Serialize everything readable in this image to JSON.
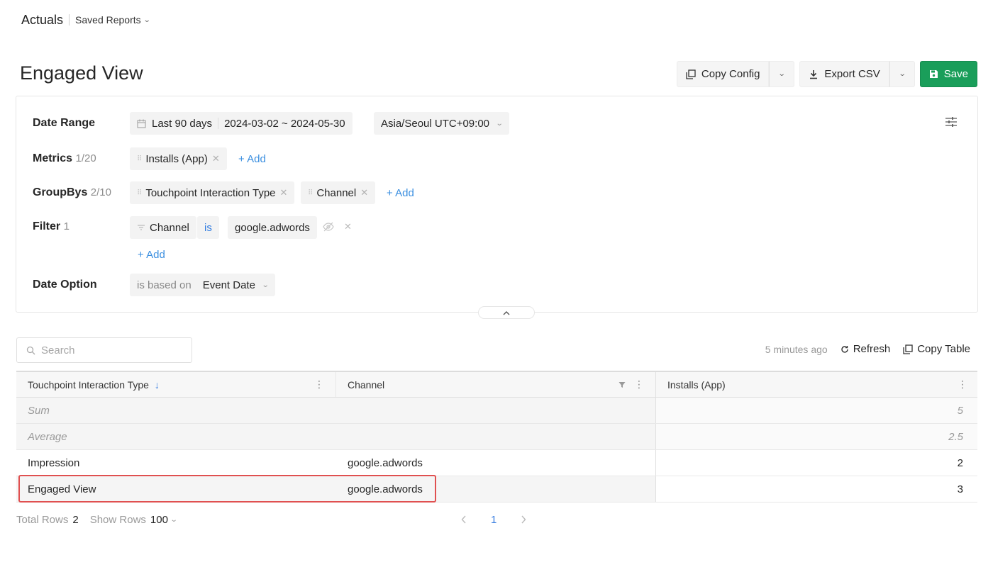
{
  "nav": {
    "title": "Actuals",
    "saved_reports": "Saved Reports"
  },
  "page_title": "Engaged View",
  "actions": {
    "copy_config": "Copy Config",
    "export_csv": "Export CSV",
    "save": "Save"
  },
  "config": {
    "date_range": {
      "label": "Date Range",
      "preset": "Last 90 days",
      "range": "2024-03-02 ~ 2024-05-30",
      "timezone": "Asia/Seoul UTC+09:00"
    },
    "metrics": {
      "label": "Metrics",
      "count": "1/20",
      "items": [
        "Installs (App)"
      ],
      "add": "+ Add"
    },
    "groupbys": {
      "label": "GroupBys",
      "count": "2/10",
      "items": [
        "Touchpoint Interaction Type",
        "Channel"
      ],
      "add": "+ Add"
    },
    "filter": {
      "label": "Filter",
      "count": "1",
      "field": "Channel",
      "operator": "is",
      "value": "google.adwords",
      "add": "+ Add"
    },
    "date_option": {
      "label": "Date Option",
      "prefix": "is based on",
      "value": "Event Date"
    }
  },
  "table_tools": {
    "search_placeholder": "Search",
    "updated": "5 minutes ago",
    "refresh": "Refresh",
    "copy_table": "Copy Table"
  },
  "table": {
    "columns": [
      "Touchpoint Interaction Type",
      "Channel",
      "Installs (App)"
    ],
    "summary": [
      {
        "label": "Sum",
        "value": "5"
      },
      {
        "label": "Average",
        "value": "2.5"
      }
    ],
    "rows": [
      {
        "type": "Impression",
        "channel": "google.adwords",
        "installs": "2"
      },
      {
        "type": "Engaged View",
        "channel": "google.adwords",
        "installs": "3"
      }
    ]
  },
  "footer": {
    "total_rows_label": "Total Rows",
    "total_rows": "2",
    "show_rows_label": "Show Rows",
    "show_rows": "100",
    "current_page": "1"
  },
  "colors": {
    "accent": "#3b8fe0",
    "save": "#1a9e5a",
    "highlight": "#e05050"
  }
}
